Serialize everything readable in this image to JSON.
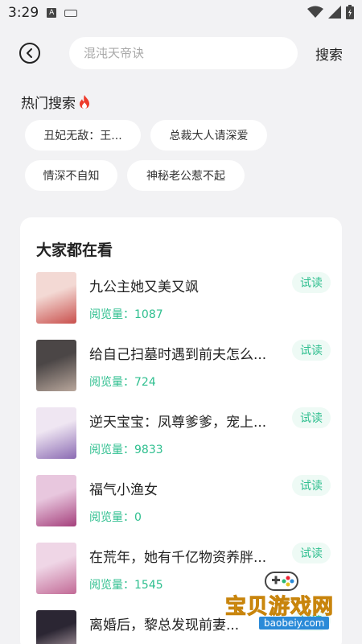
{
  "status": {
    "time": "3:29"
  },
  "header": {
    "search_placeholder": "混沌天帝诀",
    "search_label": "搜索"
  },
  "hot": {
    "title": "热门搜索",
    "chips": [
      "丑妃无敌：王...",
      "总裁大人请深爱",
      "情深不自知",
      "神秘老公惹不起"
    ]
  },
  "popular": {
    "title": "大家都在看",
    "try_label": "试读",
    "books": [
      {
        "title": "九公主她又美又飒",
        "views": "阅览量：1087",
        "cover_colors": [
          "#f3d9d4",
          "#c9504d"
        ]
      },
      {
        "title": "给自己扫墓时遇到前夫怎么...",
        "views": "阅览量：724",
        "cover_colors": [
          "#4b4646",
          "#b9a79c"
        ]
      },
      {
        "title": "逆天宝宝：凤尊爹爹，宠上...",
        "views": "阅览量：9833",
        "cover_colors": [
          "#efe6f2",
          "#8b6bb3"
        ]
      },
      {
        "title": "福气小渔女",
        "views": "阅览量：0",
        "cover_colors": [
          "#e8c7de",
          "#a5407c"
        ]
      },
      {
        "title": "在荒年，她有千亿物资养胖...",
        "views": "阅览量：1545",
        "cover_colors": [
          "#efd6e6",
          "#c26a96"
        ]
      },
      {
        "title": "离婚后，黎总发现前妻...",
        "views": "",
        "cover_colors": [
          "#2b2633",
          "#d7c2c8"
        ]
      }
    ]
  },
  "watermark": {
    "text": "宝贝游戏网",
    "url": "baobeiy.com"
  }
}
